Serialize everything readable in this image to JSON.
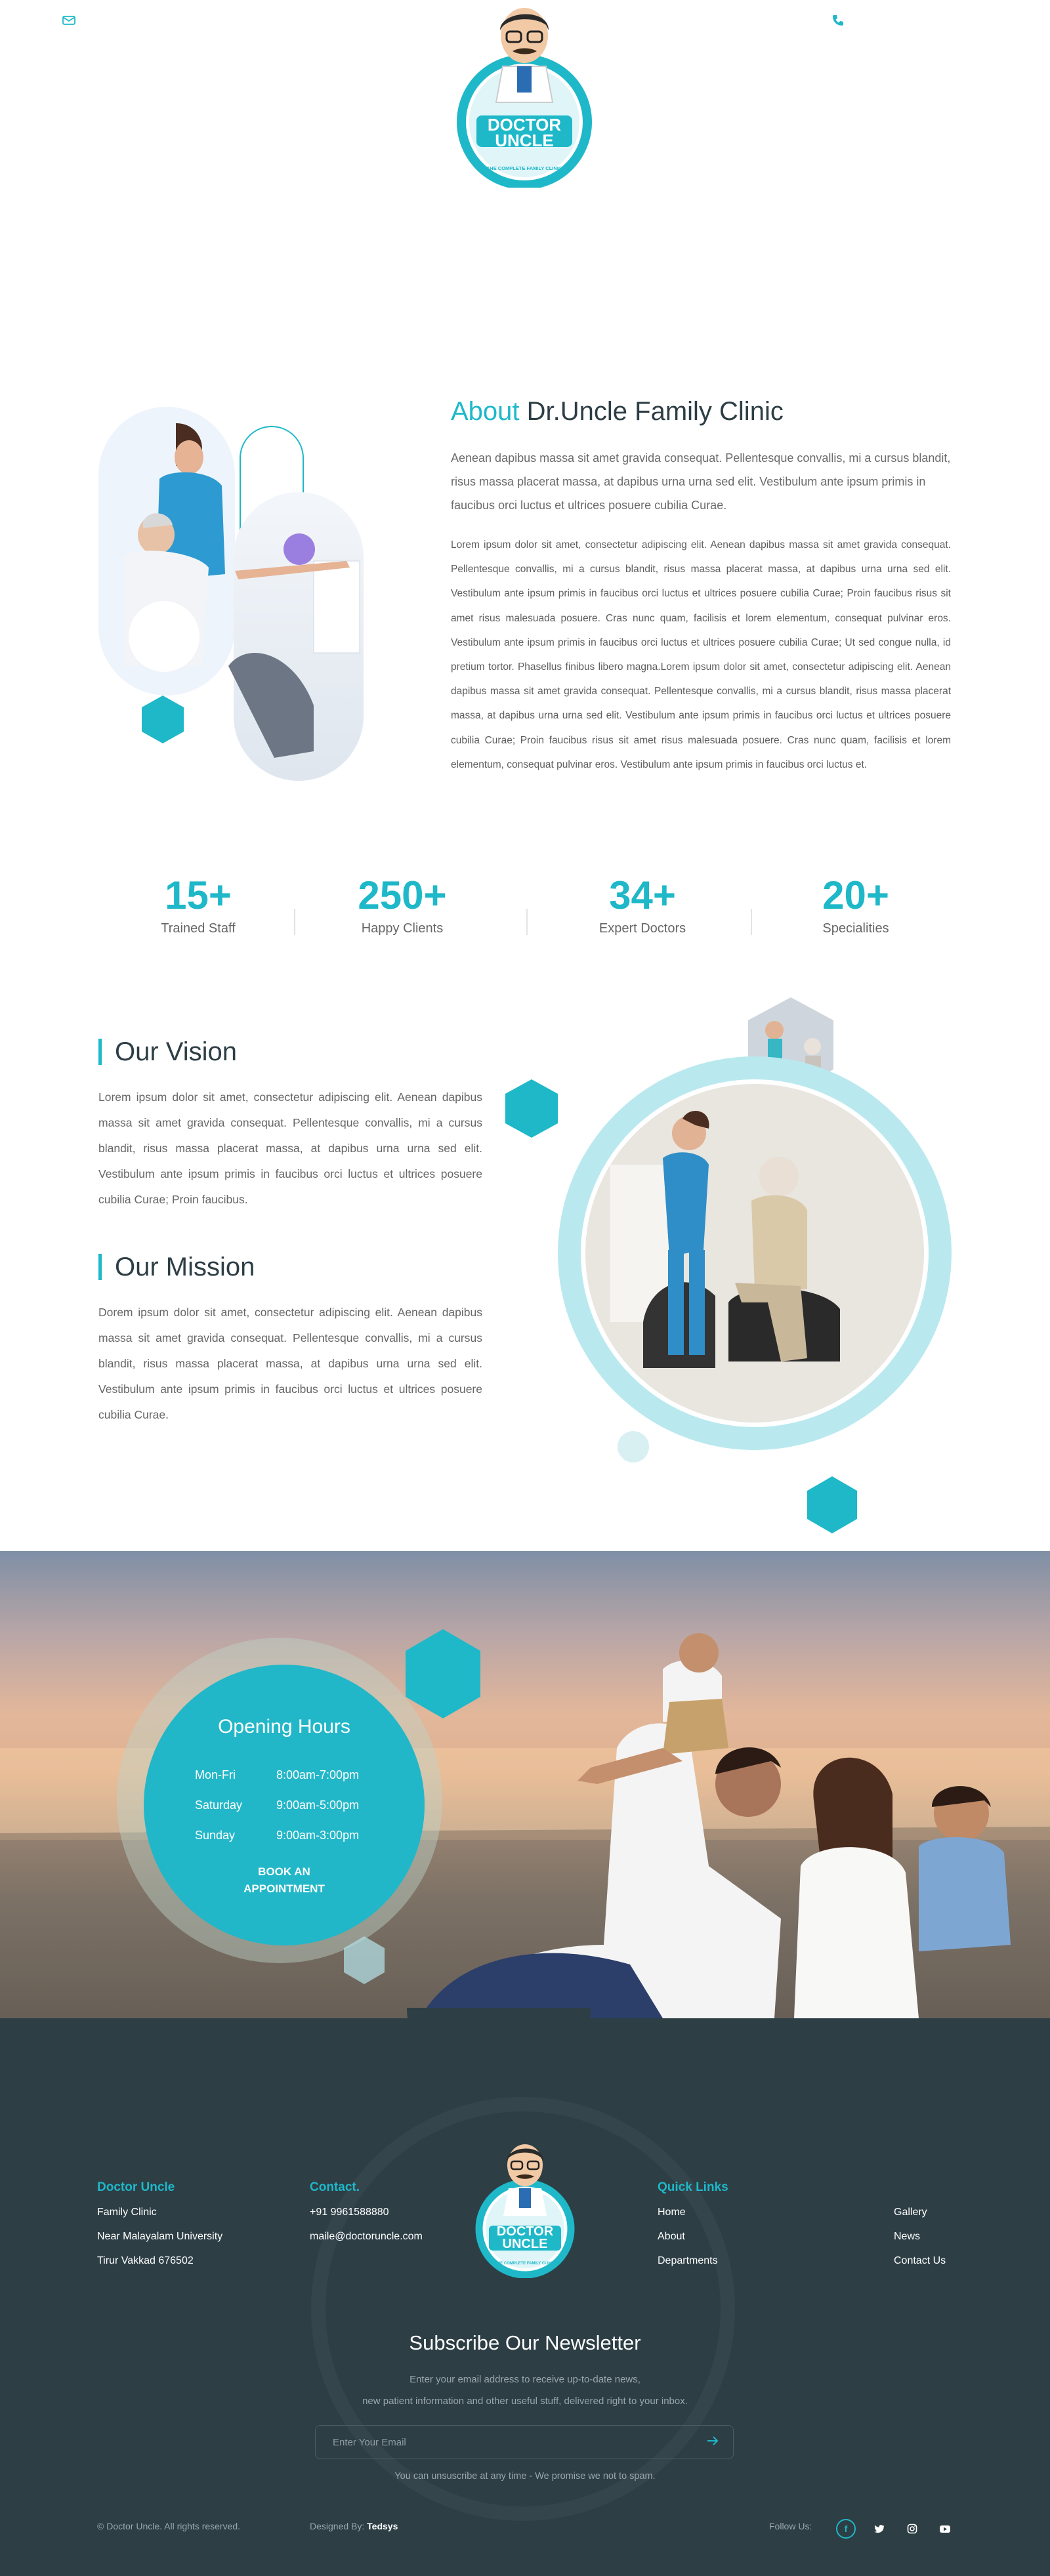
{
  "header": {
    "logo_line1": "DOCTOR",
    "logo_line2": "UNCLE",
    "logo_tagline": "THE COMPLETE FAMILY CLINIC",
    "mail_icon": "mail-icon",
    "phone_icon": "phone-icon"
  },
  "about": {
    "title_accent": "About",
    "title_rest": "Dr.Uncle Family Clinic",
    "lead": "Aenean dapibus massa sit amet gravida consequat. Pellentesque convallis, mi a cursus blandit, risus massa placerat massa, at dapibus urna urna sed elit. Vestibulum ante ipsum primis in faucibus orci luctus et ultrices posuere cubilia Curae.",
    "body": "Lorem ipsum dolor sit amet, consectetur adipiscing elit. Aenean dapibus massa sit amet gravida consequat. Pellentesque convallis, mi a cursus blandit, risus massa placerat massa, at dapibus urna urna sed elit. Vestibulum ante ipsum primis in faucibus orci luctus et ultrices posuere cubilia Curae; Proin faucibus risus sit amet risus malesuada posuere. Cras nunc quam, facilisis et lorem elementum, consequat pulvinar eros. Vestibulum ante ipsum primis in faucibus orci luctus et ultrices posuere cubilia Curae; Ut sed congue nulla, id pretium tortor. Phasellus finibus libero magna.Lorem ipsum dolor sit amet, consectetur adipiscing elit. Aenean dapibus massa sit amet gravida consequat. Pellentesque convallis, mi a cursus blandit, risus massa placerat massa, at dapibus urna urna sed elit. Vestibulum ante ipsum primis in faucibus orci luctus et ultrices posuere cubilia Curae; Proin faucibus risus sit amet risus malesuada posuere. Cras nunc quam, facilisis et lorem elementum, consequat pulvinar eros. Vestibulum ante ipsum primis in faucibus orci luctus et."
  },
  "stats": [
    {
      "num": "15+",
      "label": "Trained Staff"
    },
    {
      "num": "250+",
      "label": "Happy Clients"
    },
    {
      "num": "34+",
      "label": "Expert Doctors"
    },
    {
      "num": "20+",
      "label": "Specialities"
    }
  ],
  "vision": {
    "title": "Our Vision",
    "text": "Lorem ipsum dolor sit amet, consectetur adipiscing elit. Aenean dapibus massa sit amet gravida consequat. Pellentesque convallis, mi a cursus blandit, risus massa placerat massa, at dapibus urna urna sed elit. Vestibulum ante ipsum primis in faucibus orci luctus et ultrices posuere cubilia Curae; Proin faucibus."
  },
  "mission": {
    "title": "Our Mission",
    "text": "Dorem ipsum dolor sit amet, consectetur adipiscing elit. Aenean dapibus massa sit amet gravida consequat. Pellentesque convallis, mi a cursus blandit, risus massa placerat massa, at dapibus urna urna sed elit. Vestibulum ante ipsum primis in faucibus orci luctus et ultrices posuere cubilia Curae."
  },
  "hours": {
    "title": "Opening Hours",
    "rows": [
      {
        "day": "Mon-Fri",
        "time": "8:00am-7:00pm"
      },
      {
        "day": "Saturday",
        "time": "9:00am-5:00pm"
      },
      {
        "day": "Sunday",
        "time": "9:00am-3:00pm"
      }
    ],
    "button_line1": "BOOK AN",
    "button_line2": "APPOINTMENT"
  },
  "footer": {
    "col1": {
      "title": "Doctor Uncle",
      "lines": [
        "Family Clinic",
        "Near Malayalam University",
        "Tirur Vakkad 676502"
      ]
    },
    "col2": {
      "title": "Contact.",
      "phone": "+91 9961588880",
      "email": "maile@doctoruncle.com"
    },
    "col3": {
      "title": "Quick Links",
      "links": [
        "Home",
        "About",
        "Departments"
      ]
    },
    "col4": {
      "links": [
        "Gallery",
        "News",
        "Contact Us"
      ]
    },
    "newsletter": {
      "title": "Subscribe Our Newsletter",
      "sub1": "Enter your email address to receive up-to-date news,",
      "sub2": "new patient information and other useful stuff, delivered right to your inbox.",
      "placeholder": "Enter Your Email",
      "note": "You can unsuscribe at any time - We promise we not to spam."
    },
    "copyright": "© Doctor Uncle. All rights reserved.",
    "designed_label": "Designed By:",
    "designer": "Tedsys",
    "follow": "Follow Us:",
    "social_icons": [
      "facebook-icon",
      "twitter-icon",
      "instagram-icon",
      "youtube-icon"
    ]
  },
  "colors": {
    "accent": "#1eb8c9",
    "footer": "#2d3e45",
    "title": "#2d3e45"
  }
}
